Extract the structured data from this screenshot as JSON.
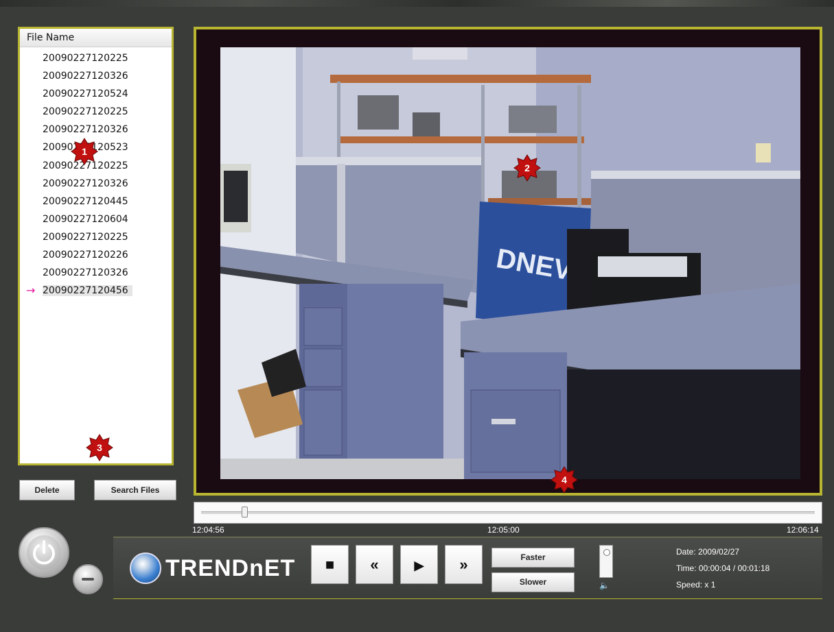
{
  "file_list": {
    "header": "File Name",
    "files": [
      "20090227120225",
      "20090227120326",
      "20090227120524",
      "20090227120225",
      "20090227120326",
      "20090227120523",
      "20090227120225",
      "20090227120326",
      "20090227120445",
      "20090227120604",
      "20090227120225",
      "20090227120226",
      "20090227120326",
      "20090227120456"
    ],
    "selected_index": 13,
    "selected_marker": "→"
  },
  "buttons": {
    "delete": "Delete",
    "search_files": "Search Files"
  },
  "badges": [
    "1",
    "2",
    "3",
    "4"
  ],
  "timeline": {
    "start": "12:04:56",
    "middle": "12:05:00",
    "end": "12:06:14",
    "position_fraction": 0.07
  },
  "controls": {
    "brand": "TRENDnET",
    "stop_icon": "stop-icon",
    "rewind_icon": "rewind-icon",
    "play_icon": "play-icon",
    "fast_forward_icon": "fast-forward-icon",
    "faster": "Faster",
    "slower": "Slower",
    "volume_icon": "speaker-icon"
  },
  "info": {
    "date": "Date: 2009/02/27",
    "time": "Time: 00:00:04 / 00:01:18",
    "speed": "Speed: x 1"
  },
  "colors": {
    "accent_border": "#b8b531",
    "badge_red": "#c0100f",
    "selected_arrow": "#e2139a"
  }
}
